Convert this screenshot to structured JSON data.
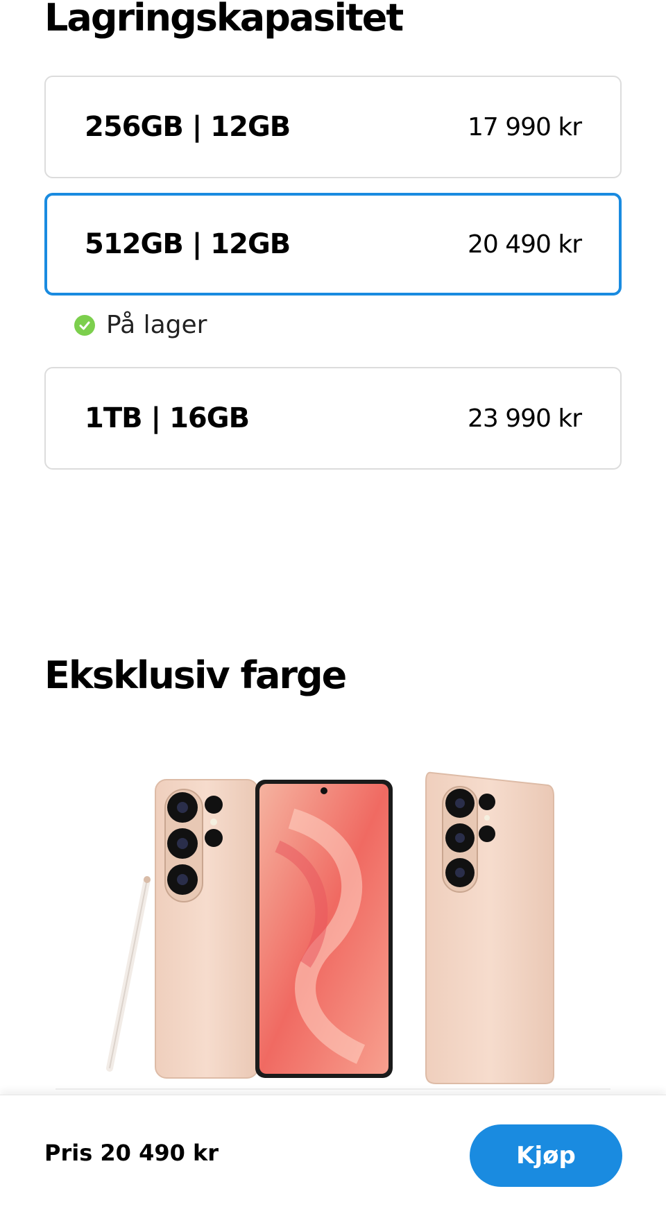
{
  "storage": {
    "title": "Lagringskapasitet",
    "options": [
      {
        "label": "256GB | 12GB",
        "price": "17 990 kr"
      },
      {
        "label": "512GB | 12GB",
        "price": "20 490 kr"
      },
      {
        "label": "1TB | 16GB",
        "price": "23 990 kr"
      }
    ],
    "stock_text": "På lager"
  },
  "color": {
    "title": "Eksklusiv farge",
    "image_colors": {
      "phone_body": "#f3d5c3",
      "screen_accent": "#f06a62"
    }
  },
  "footer": {
    "price_text": "Pris 20 490 kr",
    "buy_label": "Kjøp"
  },
  "colors": {
    "accent": "#1a8be0",
    "stock_green": "#7ccf4d"
  }
}
